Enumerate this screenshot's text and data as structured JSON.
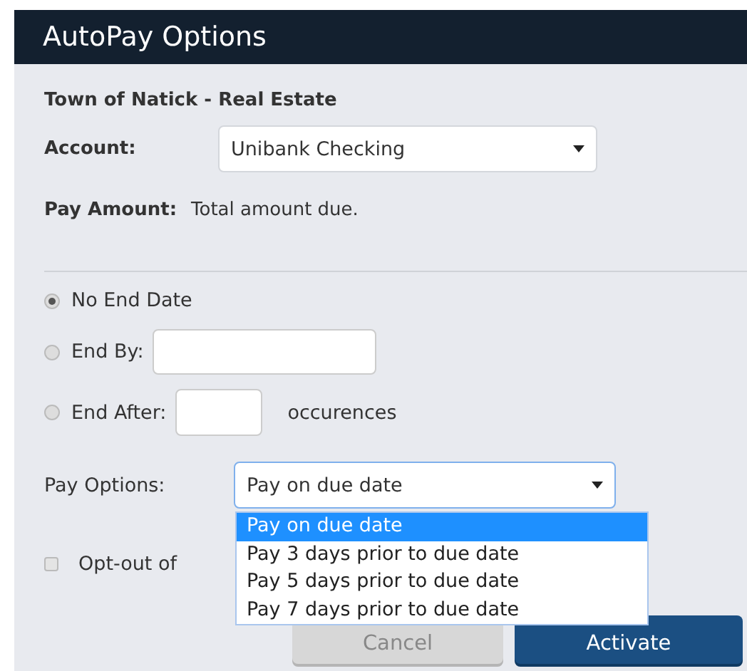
{
  "window": {
    "title": "AutoPay Options"
  },
  "biller": "Town of Natick - Real Estate",
  "account": {
    "label": "Account:",
    "value": "Unibank Checking"
  },
  "pay_amount": {
    "label": "Pay Amount:",
    "value": "Total amount due."
  },
  "end_options": [
    {
      "kind": "plain",
      "label": "No End Date",
      "selected": true
    },
    {
      "kind": "date",
      "label": "End By:",
      "selected": false
    },
    {
      "kind": "count",
      "label": "End After:",
      "suffix": "occurences",
      "selected": false
    }
  ],
  "pay_options": {
    "label": "Pay Options:",
    "value": "Pay on due date",
    "expanded": true,
    "options": [
      {
        "label": "Pay on due date",
        "selected": true
      },
      {
        "label": "Pay 3 days prior to due date",
        "selected": false
      },
      {
        "label": "Pay 5 days prior to due date",
        "selected": false
      },
      {
        "label": "Pay 7 days prior to due date",
        "selected": false
      }
    ]
  },
  "opt_out": {
    "label": "Opt-out of",
    "checked": false
  },
  "buttons": [
    {
      "label": "Cancel",
      "kind": "secondary"
    },
    {
      "label": "Activate",
      "kind": "primary"
    }
  ]
}
